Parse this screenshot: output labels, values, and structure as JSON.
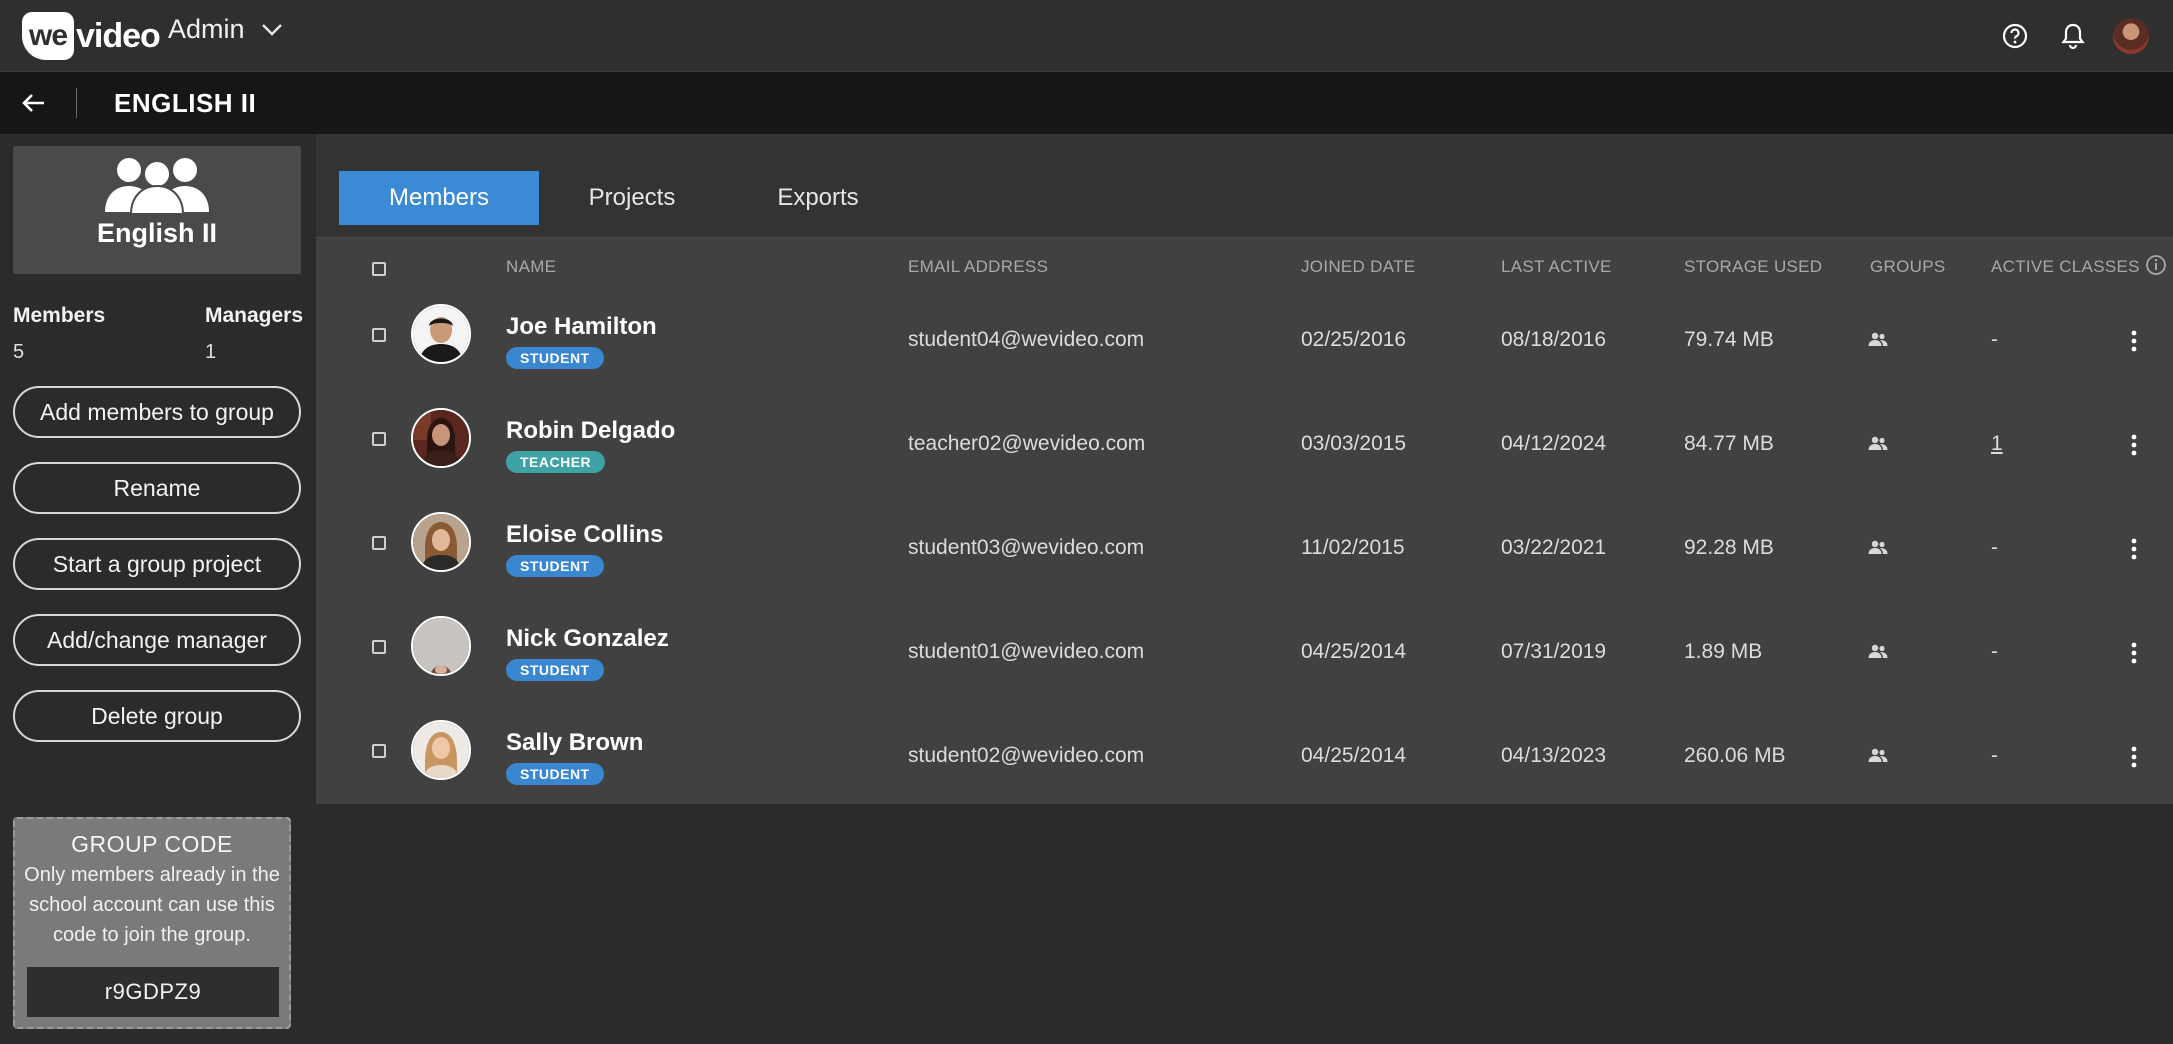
{
  "header": {
    "logo_we": "we",
    "logo_video": "video",
    "menu_label": "Admin",
    "icons": [
      "help-icon",
      "bell-icon",
      "avatar"
    ]
  },
  "subheader": {
    "title": "ENGLISH II"
  },
  "sidebar": {
    "group_name": "English II",
    "members_label": "Members",
    "members_count": "5",
    "managers_label": "Managers",
    "managers_count": "1",
    "buttons": [
      "Add members to group",
      "Rename",
      "Start a group project",
      "Add/change manager",
      "Delete group"
    ],
    "group_code": {
      "title": "GROUP CODE",
      "description": "Only members already in the school account can use this code to join the group.",
      "code": "r9GDPZ9"
    }
  },
  "tabs": [
    "Members",
    "Projects",
    "Exports"
  ],
  "active_tab": "Members",
  "table": {
    "headers": [
      "NAME",
      "EMAIL ADDRESS",
      "JOINED DATE",
      "LAST ACTIVE",
      "STORAGE USED",
      "GROUPS",
      "ACTIVE CLASSES"
    ],
    "rows": [
      {
        "name": "Joe Hamilton",
        "role": "STUDENT",
        "email": "student04@wevideo.com",
        "joined": "02/25/2016",
        "last_active": "08/18/2016",
        "storage": "79.74 MB",
        "active_classes": "-"
      },
      {
        "name": "Robin Delgado",
        "role": "TEACHER",
        "email": "teacher02@wevideo.com",
        "joined": "03/03/2015",
        "last_active": "04/12/2024",
        "storage": "84.77 MB",
        "active_classes": "1"
      },
      {
        "name": "Eloise Collins",
        "role": "STUDENT",
        "email": "student03@wevideo.com",
        "joined": "11/02/2015",
        "last_active": "03/22/2021",
        "storage": "92.28 MB",
        "active_classes": "-"
      },
      {
        "name": "Nick Gonzalez",
        "role": "STUDENT",
        "email": "student01@wevideo.com",
        "joined": "04/25/2014",
        "last_active": "07/31/2019",
        "storage": "1.89 MB",
        "active_classes": "-"
      },
      {
        "name": "Sally Brown",
        "role": "STUDENT",
        "email": "student02@wevideo.com",
        "joined": "04/25/2014",
        "last_active": "04/13/2023",
        "storage": "260.06 MB",
        "active_classes": "-"
      }
    ]
  },
  "colors": {
    "accent": "#3a8ad6",
    "student_badge": "#3a86d0",
    "teacher_badge": "#3fa3a5"
  }
}
